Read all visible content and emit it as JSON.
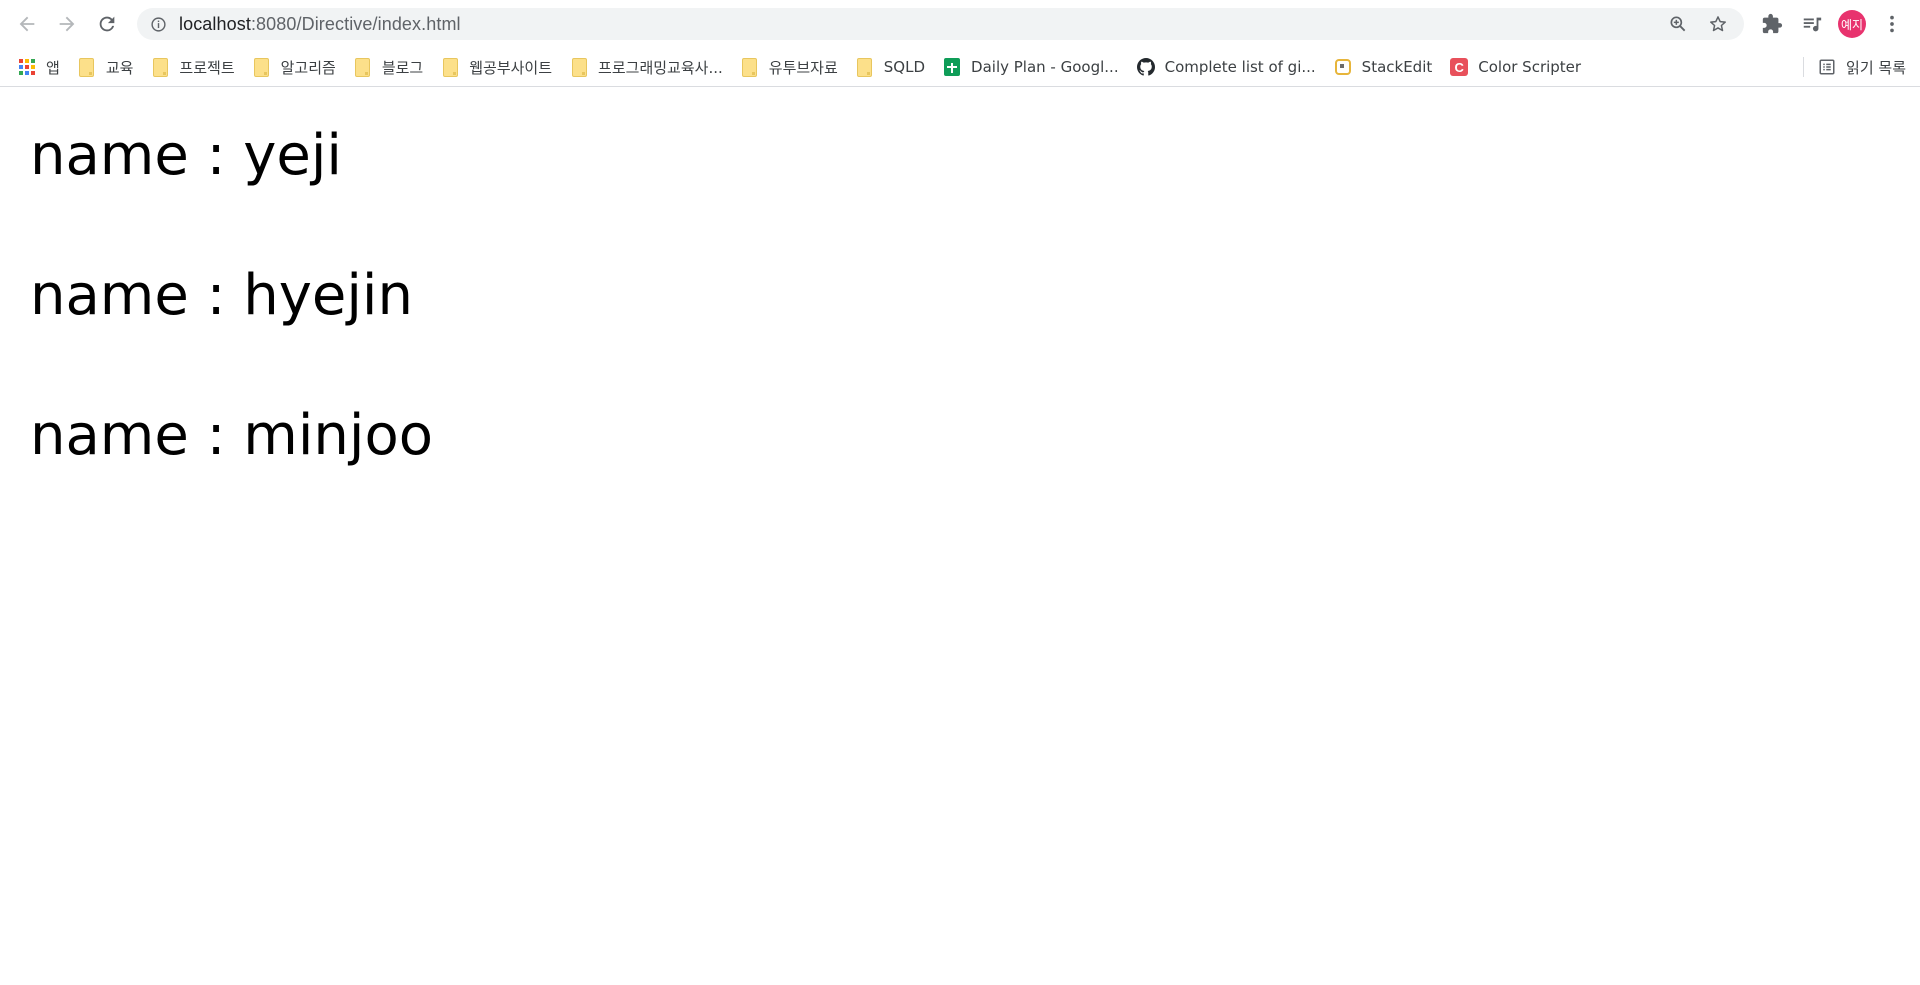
{
  "browser": {
    "url_host": "localhost",
    "url_rest": ":8080/Directive/index.html",
    "profile_initials": "예지"
  },
  "bookmarks": [
    {
      "label": "앱",
      "icon": "apps-grid-icon"
    },
    {
      "label": "교육",
      "icon": "folder-icon"
    },
    {
      "label": "프로젝트",
      "icon": "folder-icon"
    },
    {
      "label": "알고리즘",
      "icon": "folder-icon"
    },
    {
      "label": "블로그",
      "icon": "folder-icon"
    },
    {
      "label": "웹공부사이트",
      "icon": "folder-icon"
    },
    {
      "label": "프로그래밍교육사...",
      "icon": "folder-icon"
    },
    {
      "label": "유투브자료",
      "icon": "folder-icon"
    },
    {
      "label": "SQLD",
      "icon": "folder-icon"
    },
    {
      "label": "Daily Plan - Googl...",
      "icon": "google-sheets-icon"
    },
    {
      "label": "Complete list of gi...",
      "icon": "github-icon"
    },
    {
      "label": "StackEdit",
      "icon": "stackedit-icon"
    },
    {
      "label": "Color Scripter",
      "icon": "color-scripter-icon"
    }
  ],
  "reading_list": {
    "label": "읽기 목록"
  },
  "content": {
    "rows": [
      {
        "text": "name : yeji"
      },
      {
        "text": "name : hyejin"
      },
      {
        "text": "name : minjoo"
      }
    ]
  },
  "colors": {
    "avatar_bg": "#e8336e",
    "omnibox_bg": "#f1f3f4",
    "folder": "#fce08a"
  }
}
